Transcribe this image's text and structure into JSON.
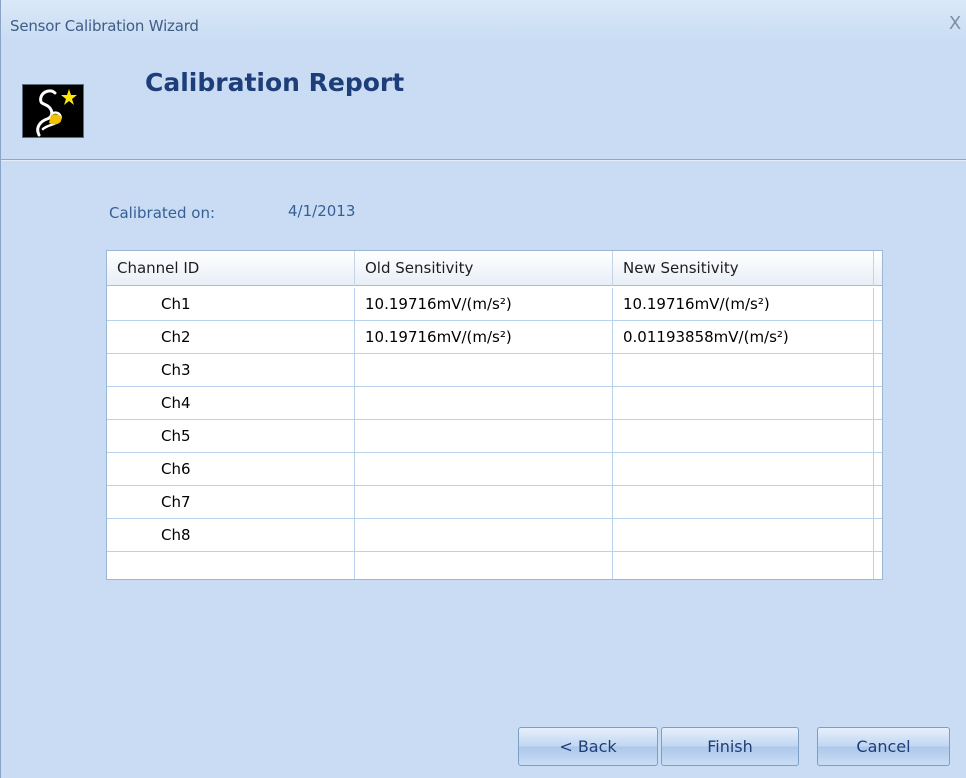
{
  "window": {
    "title": "Sensor Calibration Wizard",
    "close_label": "X"
  },
  "header": {
    "title": "Calibration Report",
    "logo_icon": "wizard-logo-icon"
  },
  "calibration": {
    "label": "Calibrated on:",
    "date": "4/1/2013"
  },
  "grid": {
    "columns": [
      "Channel ID",
      "Old Sensitivity",
      "New Sensitivity"
    ],
    "rows": [
      {
        "id": "Ch1",
        "old": "10.19716mV/(m/s²)",
        "new": "10.19716mV/(m/s²)"
      },
      {
        "id": "Ch2",
        "old": "10.19716mV/(m/s²)",
        "new": "0.01193858mV/(m/s²)"
      },
      {
        "id": "Ch3",
        "old": "",
        "new": ""
      },
      {
        "id": "Ch4",
        "old": "",
        "new": ""
      },
      {
        "id": "Ch5",
        "old": "",
        "new": ""
      },
      {
        "id": "Ch6",
        "old": "",
        "new": ""
      },
      {
        "id": "Ch7",
        "old": "",
        "new": ""
      },
      {
        "id": "Ch8",
        "old": "",
        "new": ""
      },
      {
        "id": "",
        "old": "",
        "new": ""
      }
    ]
  },
  "buttons": {
    "back": "< Back",
    "finish": "Finish",
    "cancel": "Cancel"
  },
  "colors": {
    "window_bg": "#c9dcf3",
    "title_accent": "#1d3e78",
    "grid_line": "#b8d3eb"
  }
}
